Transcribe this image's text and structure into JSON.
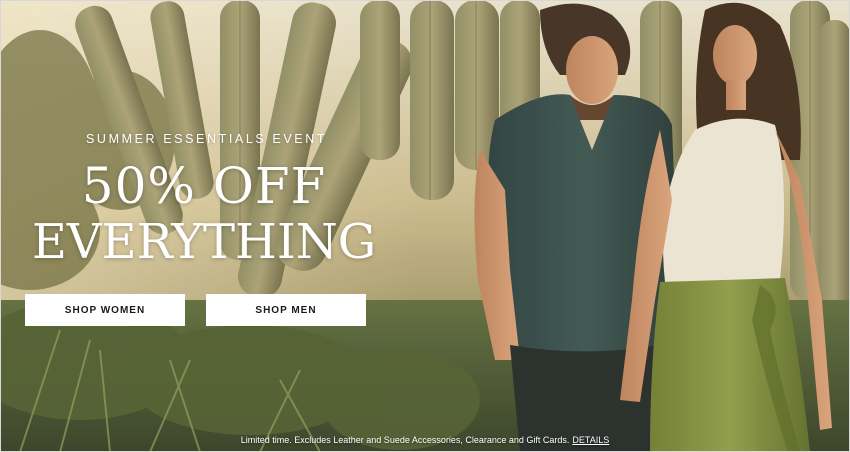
{
  "hero": {
    "eyebrow": "SUMMER ESSENTIALS EVENT",
    "headline_line1": "50% OFF",
    "headline_line2": "EVERYTHING",
    "buttons": {
      "shop_women": "SHOP WOMEN",
      "shop_men": "SHOP MEN"
    },
    "disclaimer": "Limited time. Excludes Leather and Suede Accessories, Clearance and Gift Cards.",
    "details_link": "DETAILS"
  },
  "colors": {
    "button_bg": "#ffffff",
    "button_text": "#1a1a1a",
    "headline_text": "#ffffff",
    "shirt_teal": "#2f4a4a",
    "skirt_olive": "#7a8a3a",
    "top_cream": "#ece5d6"
  }
}
